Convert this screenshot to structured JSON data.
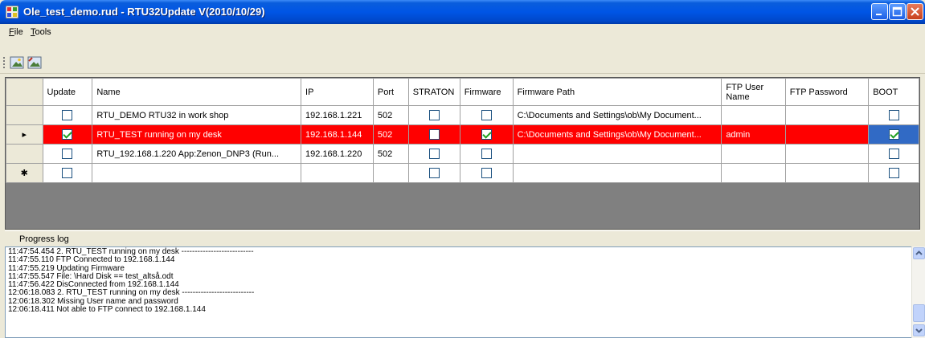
{
  "window": {
    "title": "Ole_test_demo.rud - RTU32Update V(2010/10/29)"
  },
  "menu": {
    "items": [
      {
        "label_first": "F",
        "label_rest": "ile"
      },
      {
        "label_first": "T",
        "label_rest": "ools"
      }
    ]
  },
  "toolbar": {
    "buttons": [
      "image-icon",
      "image-edit-icon"
    ]
  },
  "grid": {
    "columns": [
      "Update",
      "Name",
      "IP",
      "Port",
      "STRATON",
      "Firmware",
      "Firmware Path",
      "FTP User Name",
      "FTP Password",
      "BOOT"
    ],
    "rows": [
      {
        "indicator": "",
        "update": false,
        "name": "RTU_DEMO RTU32 in work shop",
        "ip": "192.168.1.221",
        "port": "502",
        "straton": false,
        "firmware": false,
        "firmware_path": "C:\\Documents and Settings\\ob\\My Document...",
        "ftp_user": "",
        "ftp_password": "",
        "boot": false
      },
      {
        "indicator": "▸",
        "update": true,
        "name": "RTU_TEST running on my desk",
        "ip": "192.168.1.144",
        "port": "502",
        "straton": false,
        "firmware": true,
        "firmware_path": "C:\\Documents and Settings\\ob\\My Document...",
        "ftp_user": "admin",
        "ftp_password": "",
        "boot": true
      },
      {
        "indicator": "",
        "update": false,
        "name": "RTU_192.168.1.220  App:Zenon_DNP3 (Run...",
        "ip": "192.168.1.220",
        "port": "502",
        "straton": false,
        "firmware": false,
        "firmware_path": "",
        "ftp_user": "",
        "ftp_password": "",
        "boot": false
      },
      {
        "indicator": "✱",
        "update": false,
        "name": "",
        "ip": "",
        "port": "",
        "straton": false,
        "firmware": false,
        "firmware_path": "",
        "ftp_user": "",
        "ftp_password": "",
        "boot": false
      }
    ]
  },
  "progress_log": {
    "label": "Progress log",
    "lines": [
      "11:47:54.454 2. RTU_TEST running on my desk ---------------------------",
      "11:47:55.110 FTP Connected to 192.168.1.144",
      "11:47:55.219 Updating Firmware",
      "11:47:55.547 File: \\Hard Disk == test_altså.odt",
      "11:47:56.422 DisConnected from 192.168.1.144",
      "12:06:18.083 2. RTU_TEST running on my desk ---------------------------",
      "12:06:18.302 Missing User name and password",
      "12:06:18.411 Not able to FTP connect to 192.168.1.144"
    ]
  },
  "colors": {
    "selected_row": "#ff0000",
    "titlebar": "#0055e5"
  }
}
